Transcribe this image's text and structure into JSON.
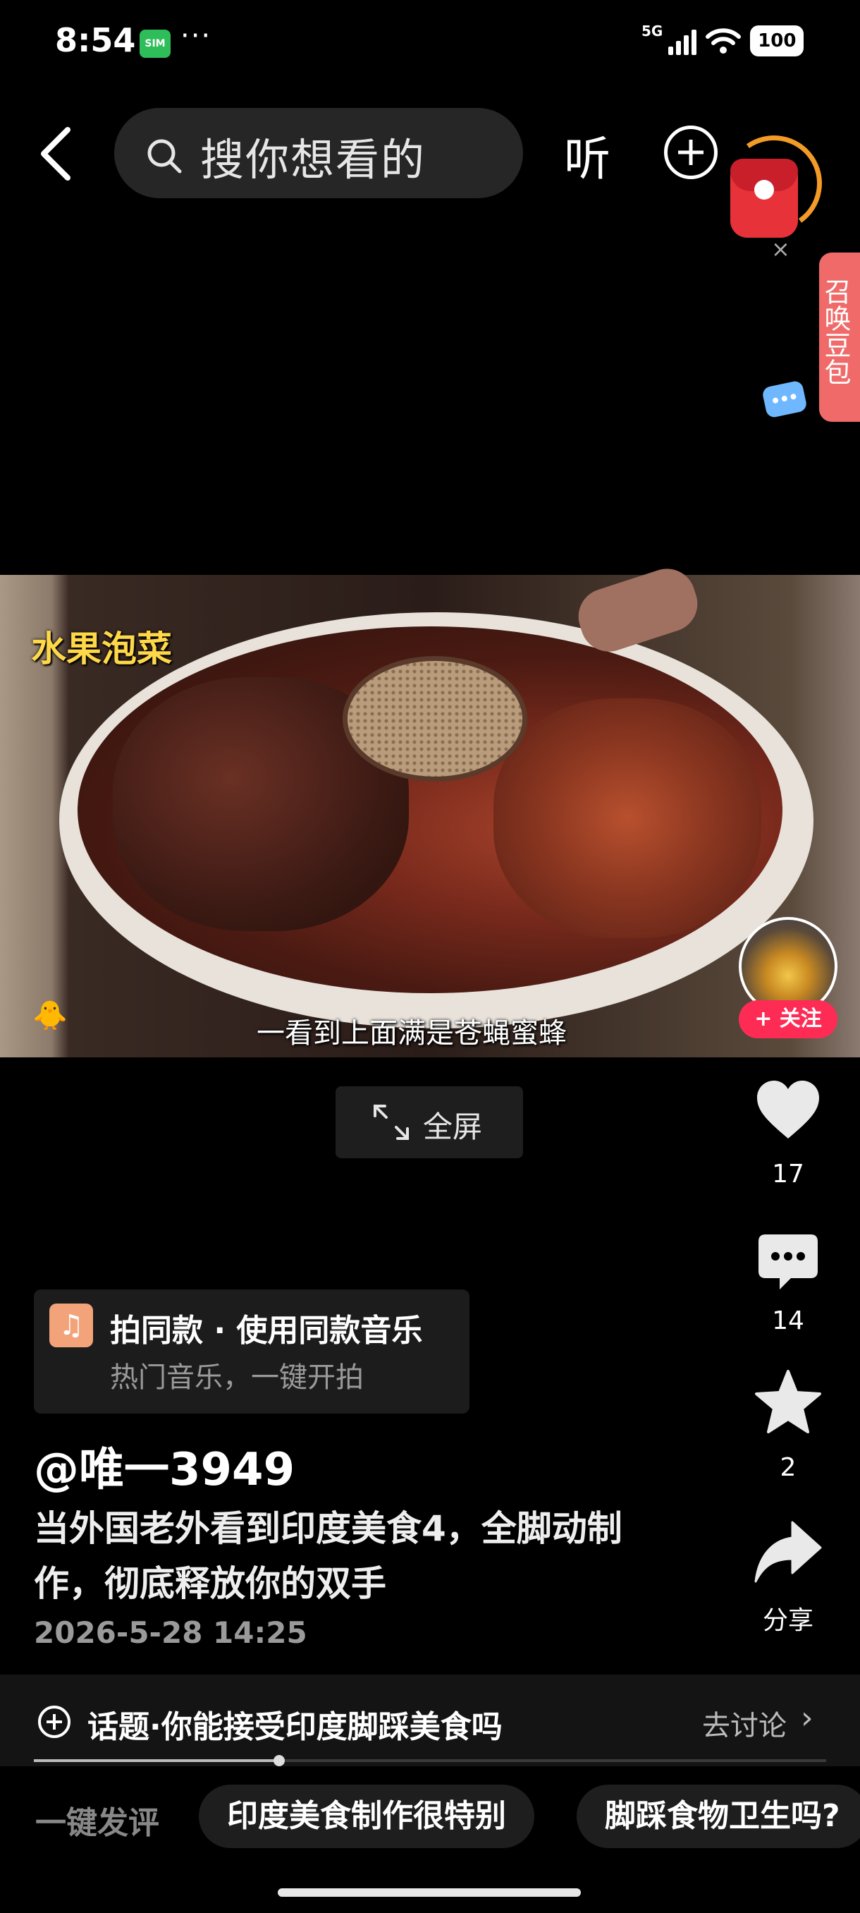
{
  "status_bar": {
    "time": "8:54",
    "app_badge": "SIM",
    "more": "···",
    "network": "5G",
    "battery": "100"
  },
  "top_bar": {
    "search_placeholder": "搜你想看的",
    "listen_label": "听",
    "icons": [
      "back-arrow-icon",
      "search-icon",
      "plus-circle-icon",
      "red-envelope-icon"
    ]
  },
  "assistant_tab": {
    "label": "召唤豆包",
    "close": "×"
  },
  "video": {
    "overlay_title": "水果泡菜",
    "subtitle": "一看到上面满是苍蝇蜜蜂",
    "sticker": "🐥",
    "fullscreen_label": "全屏"
  },
  "creator": {
    "follow_label": "+ 关注"
  },
  "actions": {
    "likes": "17",
    "comments": "14",
    "favorites": "2",
    "share_label": "分享"
  },
  "music": {
    "title": "拍同款 · 使用同款音乐",
    "subtitle": "热门音乐，一键开拍"
  },
  "post": {
    "author": "@唯一3949",
    "description": "当外国老外看到印度美食4，全脚动制作，彻底释放你的双手",
    "date": "2026-5-28 14:25"
  },
  "topic": {
    "text": "话题·你能接受印度脚踩美食吗",
    "link": "去讨论",
    "chevron": "›"
  },
  "playback": {
    "progress": 0.31
  },
  "quick_comments": {
    "label": "一键发评",
    "chips": [
      "印度美食制作很特别",
      "脚踩食物卫生吗?"
    ]
  },
  "colors": {
    "background": "#000000",
    "follow_red": "#fe2c55",
    "assistant_pink": "#f06a6a",
    "caption_yellow": "#ffd84a",
    "card_bg": "#1c1c1c"
  }
}
